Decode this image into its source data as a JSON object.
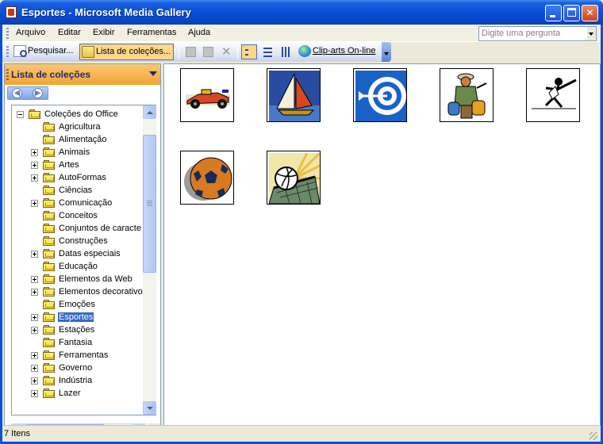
{
  "window": {
    "title": "Esportes - Microsoft Media Gallery"
  },
  "menu": {
    "items": [
      "Arquivo",
      "Editar",
      "Exibir",
      "Ferramentas",
      "Ajuda"
    ],
    "ask_placeholder": "Digite uma pergunta"
  },
  "toolbar": {
    "search_label": "Pesquisar...",
    "collections_label": "Lista de coleções...",
    "clipart_label": "Clip-arts On-line"
  },
  "pane": {
    "title": "Lista de coleções",
    "tree": [
      {
        "label": "Coleções do Office",
        "level": 0,
        "expander": "minus"
      },
      {
        "label": "Agricultura",
        "level": 1,
        "expander": "none"
      },
      {
        "label": "Alimentação",
        "level": 1,
        "expander": "none"
      },
      {
        "label": "Animais",
        "level": 1,
        "expander": "plus"
      },
      {
        "label": "Artes",
        "level": 1,
        "expander": "plus"
      },
      {
        "label": "AutoFormas",
        "level": 1,
        "expander": "plus"
      },
      {
        "label": "Ciências",
        "level": 1,
        "expander": "none"
      },
      {
        "label": "Comunicação",
        "level": 1,
        "expander": "plus"
      },
      {
        "label": "Conceitos",
        "level": 1,
        "expander": "none"
      },
      {
        "label": "Conjuntos de caracte",
        "level": 1,
        "expander": "none"
      },
      {
        "label": "Construções",
        "level": 1,
        "expander": "none"
      },
      {
        "label": "Datas especiais",
        "level": 1,
        "expander": "plus"
      },
      {
        "label": "Educação",
        "level": 1,
        "expander": "none"
      },
      {
        "label": "Elementos da Web",
        "level": 1,
        "expander": "plus"
      },
      {
        "label": "Elementos decorativo",
        "level": 1,
        "expander": "plus"
      },
      {
        "label": "Emoções",
        "level": 1,
        "expander": "none"
      },
      {
        "label": "Esportes",
        "level": 1,
        "expander": "plus",
        "selected": true
      },
      {
        "label": "Estações",
        "level": 1,
        "expander": "plus"
      },
      {
        "label": "Fantasia",
        "level": 1,
        "expander": "none"
      },
      {
        "label": "Ferramentas",
        "level": 1,
        "expander": "plus"
      },
      {
        "label": "Governo",
        "level": 1,
        "expander": "plus"
      },
      {
        "label": "Indústria",
        "level": 1,
        "expander": "plus"
      },
      {
        "label": "Lazer",
        "level": 1,
        "expander": "plus"
      }
    ]
  },
  "gallery": {
    "items": [
      "race-car",
      "sailboat",
      "archery-target",
      "hiker",
      "fencer",
      "soccer-ball",
      "volleyball"
    ]
  },
  "status": {
    "text": "7 Itens"
  }
}
